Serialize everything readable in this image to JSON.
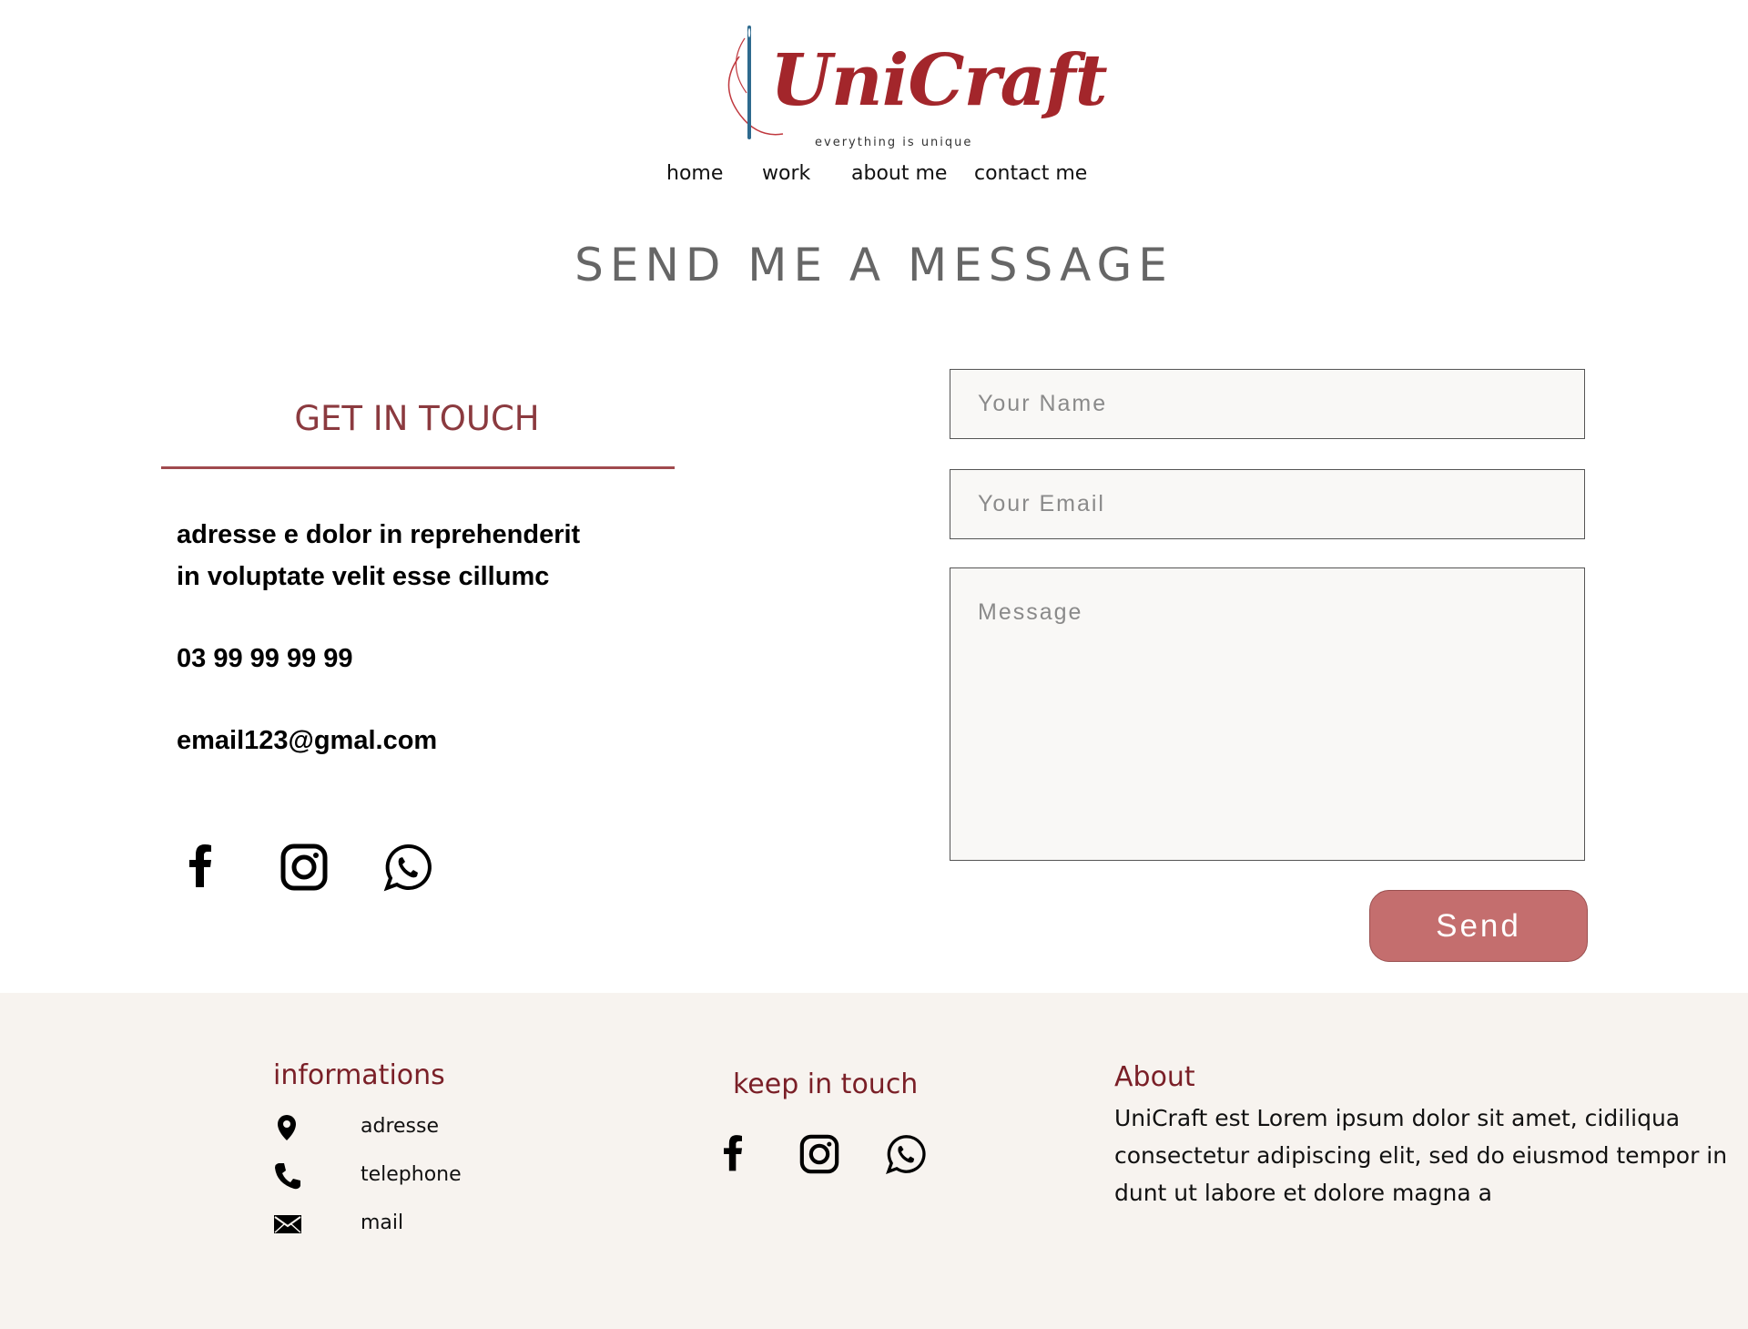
{
  "logo": {
    "brand": "UniCraft",
    "tagline": "everything is unique",
    "brand_color": "#a3262b"
  },
  "nav": {
    "items": [
      "home",
      "work",
      "about me",
      "contact me"
    ]
  },
  "page_title": "SEND ME A MESSAGE",
  "get_in_touch": {
    "title": "GET IN TOUCH",
    "address_line1": "adresse e dolor in reprehenderit",
    "address_line2": "in voluptate velit esse cillumc",
    "phone": "03 99 99 99 99",
    "email": "email123@gmal.com",
    "social_icons": [
      "facebook-icon",
      "instagram-icon",
      "whatsapp-icon"
    ]
  },
  "form": {
    "name_placeholder": "Your Name",
    "email_placeholder": "Your Email",
    "message_placeholder": "Message",
    "send_label": "Send",
    "send_color": "#c46e6e"
  },
  "footer": {
    "background": "#f7f3ef",
    "heading_color": "#7a1f27",
    "informations": {
      "heading": "informations",
      "items": [
        {
          "icon": "location-pin-icon",
          "label": "adresse"
        },
        {
          "icon": "phone-icon",
          "label": "telephone"
        },
        {
          "icon": "mail-icon",
          "label": "mail"
        }
      ]
    },
    "keep_in_touch": {
      "heading": "keep in touch",
      "social_icons": [
        "facebook-icon",
        "instagram-icon",
        "whatsapp-icon"
      ]
    },
    "about": {
      "heading": "About",
      "text": "UniCraft est Lorem ipsum dolor sit amet, cidiliqua consectetur adipiscing elit, sed do eiusmod tempor in dunt ut labore et dolore magna a"
    }
  }
}
